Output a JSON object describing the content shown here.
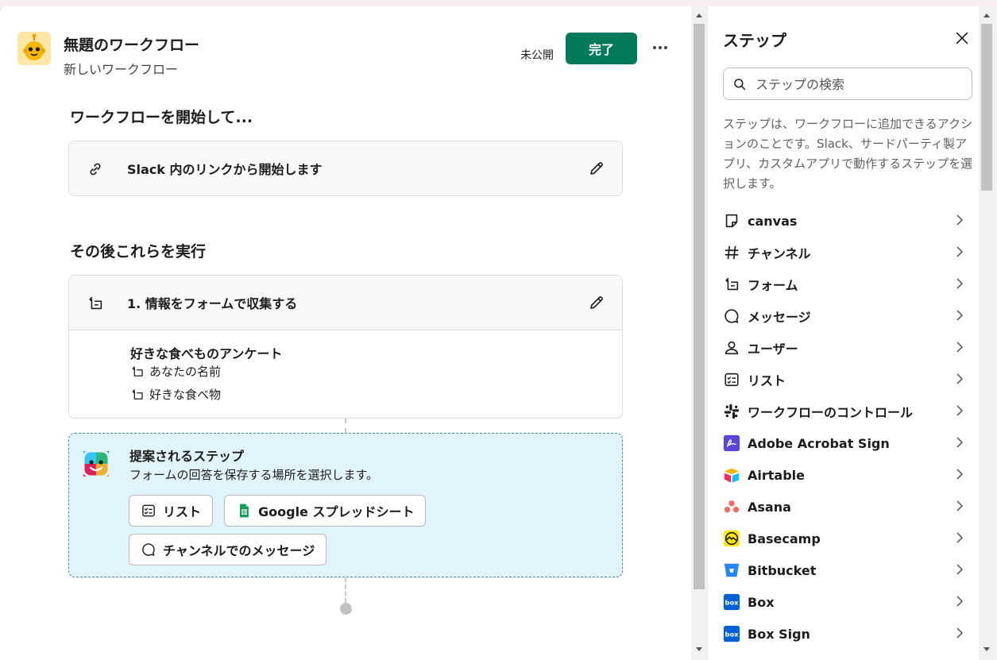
{
  "workflow": {
    "title": "無題のワークフロー",
    "subtitle": "新しいワークフロー",
    "status": "未公開",
    "done_label": "完了"
  },
  "start_section": {
    "title": "ワークフローを開始して...",
    "trigger_label": "Slack 内のリンクから開始します"
  },
  "then_section": {
    "title": "その後これらを実行",
    "step_label": "1. 情報をフォームで収集する",
    "form_name": "好きな食べものアンケート",
    "fields": [
      "あなたの名前",
      "好きな食べ物"
    ]
  },
  "suggested": {
    "title": "提案されるステップ",
    "description": "フォームの回答を保存する場所を選択します。",
    "chips": [
      "リスト",
      "Google スプレッドシート",
      "チャンネルでのメッセージ"
    ]
  },
  "steps_panel": {
    "title": "ステップ",
    "search_placeholder": "ステップの検索",
    "description": "ステップは、ワークフローに追加できるアクションのことです。Slack、サードパーティ製アプリ、カスタムアプリで動作するステップを選択します。",
    "items": [
      {
        "label": "canvas",
        "icon": "canvas-icon"
      },
      {
        "label": "チャンネル",
        "icon": "hash-icon"
      },
      {
        "label": "フォーム",
        "icon": "form-icon"
      },
      {
        "label": "メッセージ",
        "icon": "message-icon"
      },
      {
        "label": "ユーザー",
        "icon": "user-icon"
      },
      {
        "label": "リスト",
        "icon": "list-icon"
      },
      {
        "label": "ワークフローのコントロール",
        "icon": "slack-icon"
      },
      {
        "label": "Adobe Acrobat Sign",
        "icon": "adobe-sign-icon"
      },
      {
        "label": "Airtable",
        "icon": "airtable-icon"
      },
      {
        "label": "Asana",
        "icon": "asana-icon"
      },
      {
        "label": "Basecamp",
        "icon": "basecamp-icon"
      },
      {
        "label": "Bitbucket",
        "icon": "bitbucket-icon"
      },
      {
        "label": "Box",
        "icon": "box-icon"
      },
      {
        "label": "Box Sign",
        "icon": "box-sign-icon"
      }
    ]
  },
  "colors": {
    "primary_green": "#007a5a",
    "suggest_bg": "#e1f4fb",
    "suggest_border": "#3d8fa8"
  }
}
